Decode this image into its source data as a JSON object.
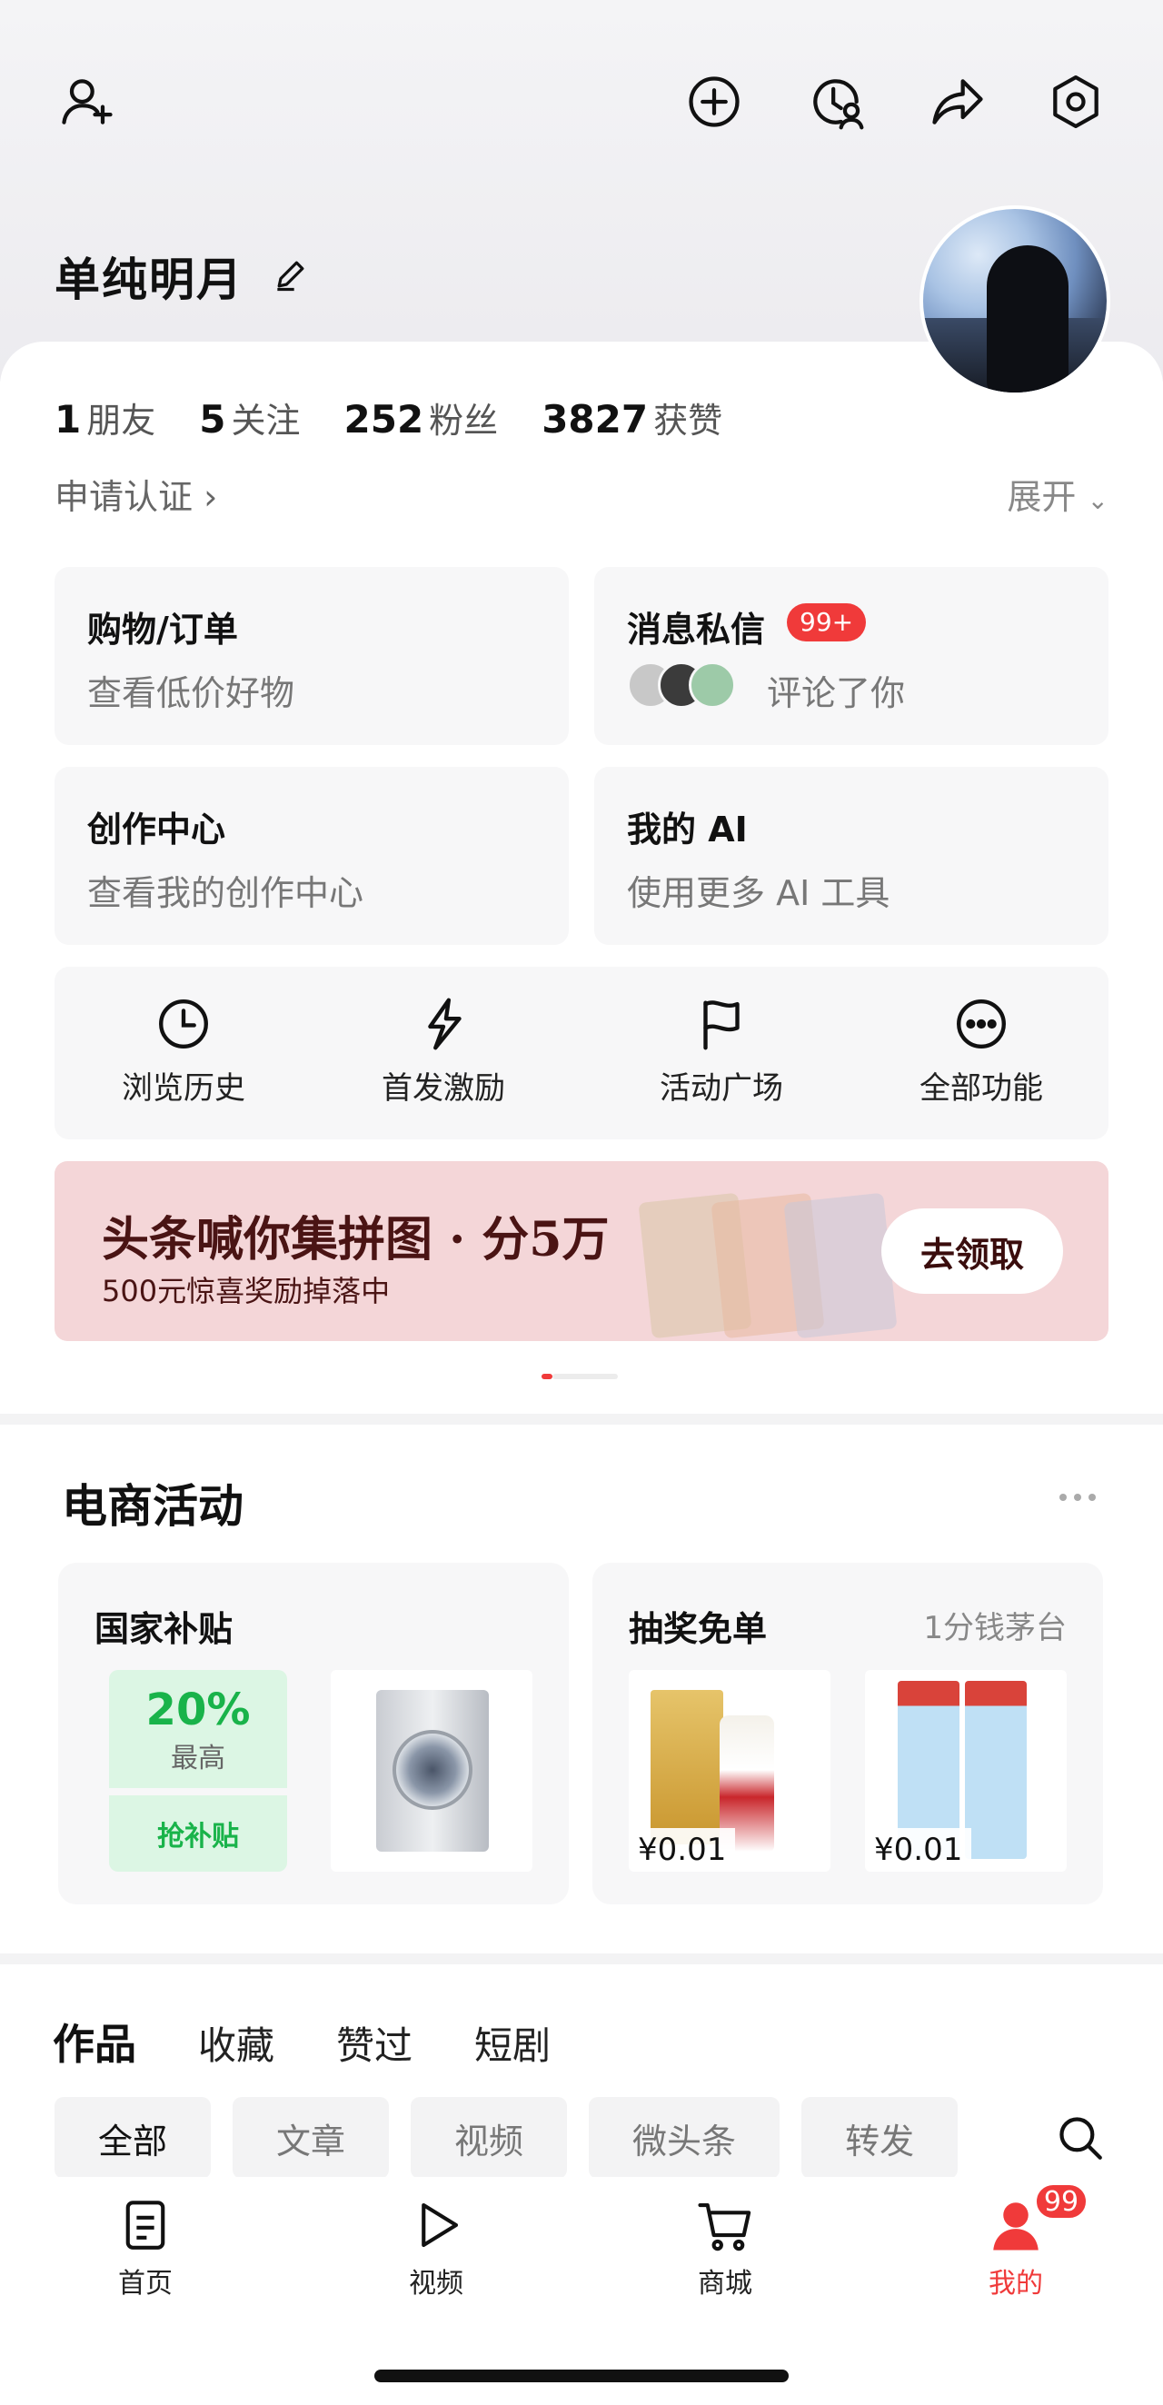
{
  "profile": {
    "username": "单纯明月",
    "stats": [
      {
        "num": "1",
        "label": "朋友"
      },
      {
        "num": "5",
        "label": "关注"
      },
      {
        "num": "252",
        "label": "粉丝"
      },
      {
        "num": "3827",
        "label": "获赞"
      }
    ],
    "verify_label": "申请认证",
    "expand_label": "展开"
  },
  "cards": {
    "shopping": {
      "title": "购物/订单",
      "sub": "查看低价好物"
    },
    "messages": {
      "title": "消息私信",
      "badge": "99+",
      "sub": "评论了你"
    },
    "creator": {
      "title": "创作中心",
      "sub": "查看我的创作中心"
    },
    "ai": {
      "title": "我的 AI",
      "sub": "使用更多 AI 工具"
    }
  },
  "shortcuts": [
    {
      "label": "浏览历史",
      "icon": "clock-icon"
    },
    {
      "label": "首发激励",
      "icon": "lightning-icon"
    },
    {
      "label": "活动广场",
      "icon": "flag-icon"
    },
    {
      "label": "全部功能",
      "icon": "more-circle-icon"
    }
  ],
  "banner": {
    "title": "头条喊你集拼图 · 分5万",
    "subtitle": "500元惊喜奖励掉落中",
    "cta": "去领取"
  },
  "ecommerce": {
    "section_title": "电商活动",
    "subsidy_card": {
      "title": "国家补贴",
      "percent": "20%",
      "high_label": "最高",
      "grab_label": "抢补贴"
    },
    "lottery_card": {
      "title": "抽奖免单",
      "note": "1分钱茅台",
      "prices": [
        "¥0.01",
        "¥0.01"
      ]
    }
  },
  "content_tabs": [
    "作品",
    "收藏",
    "赞过",
    "短剧"
  ],
  "filter_chips": [
    "全部",
    "文章",
    "视频",
    "微头条",
    "转发"
  ],
  "tabbar": {
    "items": [
      {
        "label": "首页",
        "icon": "home-icon"
      },
      {
        "label": "视频",
        "icon": "play-icon"
      },
      {
        "label": "商城",
        "icon": "cart-icon"
      },
      {
        "label": "我的",
        "icon": "user-icon"
      }
    ],
    "badge": "99"
  },
  "colors": {
    "accent": "#f03a3a",
    "green": "#19b34a",
    "banner_bg": "#f4d6d8"
  }
}
